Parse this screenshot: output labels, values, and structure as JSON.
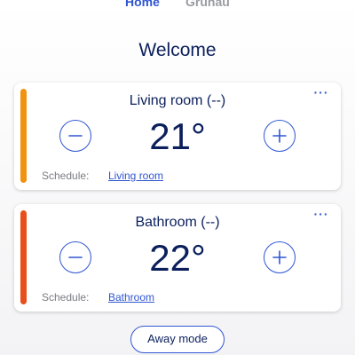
{
  "tabs": [
    {
      "label": "Home",
      "active": true
    },
    {
      "label": "Grunau",
      "active": false
    }
  ],
  "welcome": "Welcome",
  "rooms": [
    {
      "title": "Living room (--)",
      "temperature": "21°",
      "schedule_label": "Schedule:",
      "schedule_link": "Living room",
      "accent_color": "#f0930f"
    },
    {
      "title": "Bathroom (--)",
      "temperature": "22°",
      "schedule_label": "Schedule:",
      "schedule_link": "Bathroom",
      "accent_color": "#e8501b"
    }
  ],
  "icons": {
    "more": "more-horizontal-icon",
    "decrease": "minus-circle-icon",
    "increase": "plus-circle-icon"
  },
  "more_label": "···",
  "away_mode": "Away mode",
  "colors": {
    "primary": "#2f56d1",
    "text": "#0b1f5c",
    "muted": "#7a7c84"
  }
}
